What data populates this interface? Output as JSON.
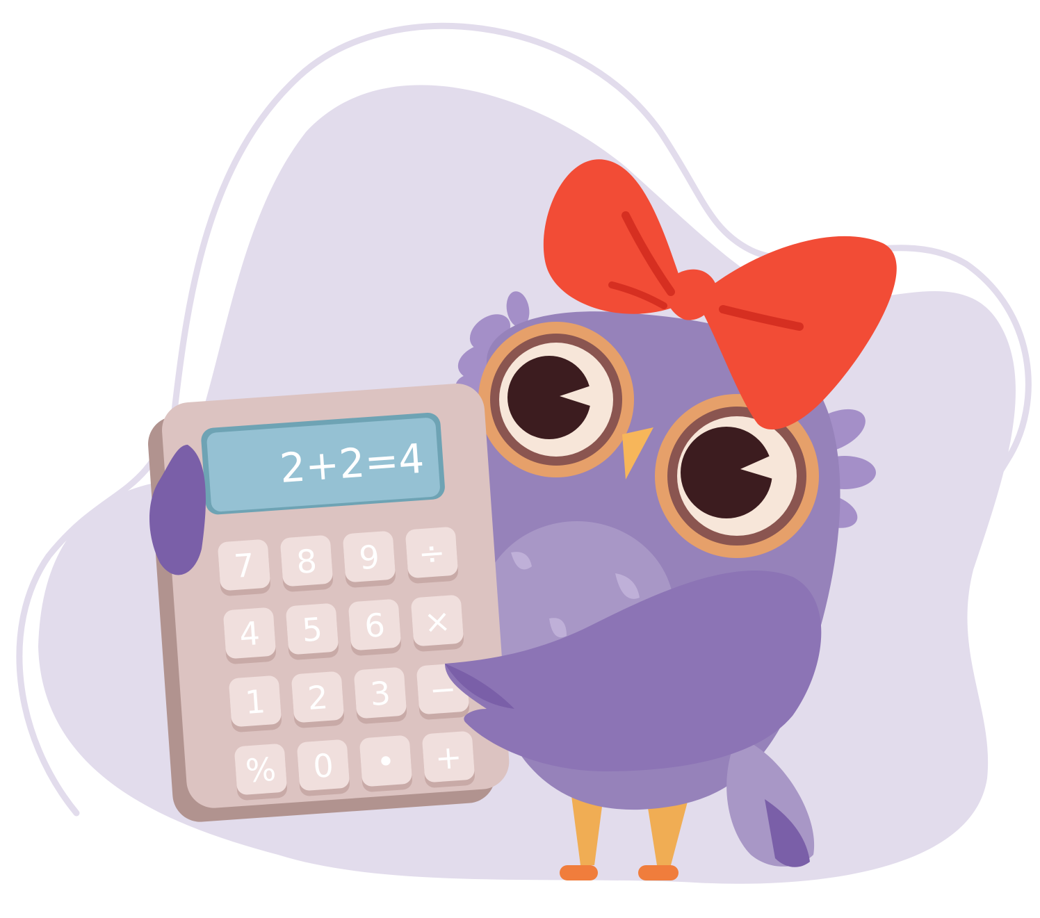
{
  "scene": {
    "background_color": "#ffffff",
    "blob_color": "#e2dcec",
    "outline_color": "#e2dcec"
  },
  "calculator": {
    "display_text": "2+2=4",
    "body_color": "#dcc3c1",
    "body_shadow_color": "#b1938f",
    "screen_color": "#95c1d3",
    "key_color": "#f0dfdd",
    "key_shadow_color": "#c8aaa7",
    "keys": [
      [
        "7",
        "8",
        "9",
        "÷"
      ],
      [
        "4",
        "5",
        "6",
        "×"
      ],
      [
        "1",
        "2",
        "3",
        "−"
      ],
      [
        "%",
        "0",
        "•",
        "+"
      ]
    ]
  },
  "owl": {
    "body_color": "#9682ba",
    "belly_color": "#a897c6",
    "wing_color": "#7a5fa8",
    "bow_color": "#f24c36",
    "bow_shadow_color": "#d62f21",
    "eye_ring_color": "#e6a06a",
    "pupil_color": "#3c1c1f",
    "beak_color": "#f7b65a",
    "feet_color": "#f0ad54"
  }
}
